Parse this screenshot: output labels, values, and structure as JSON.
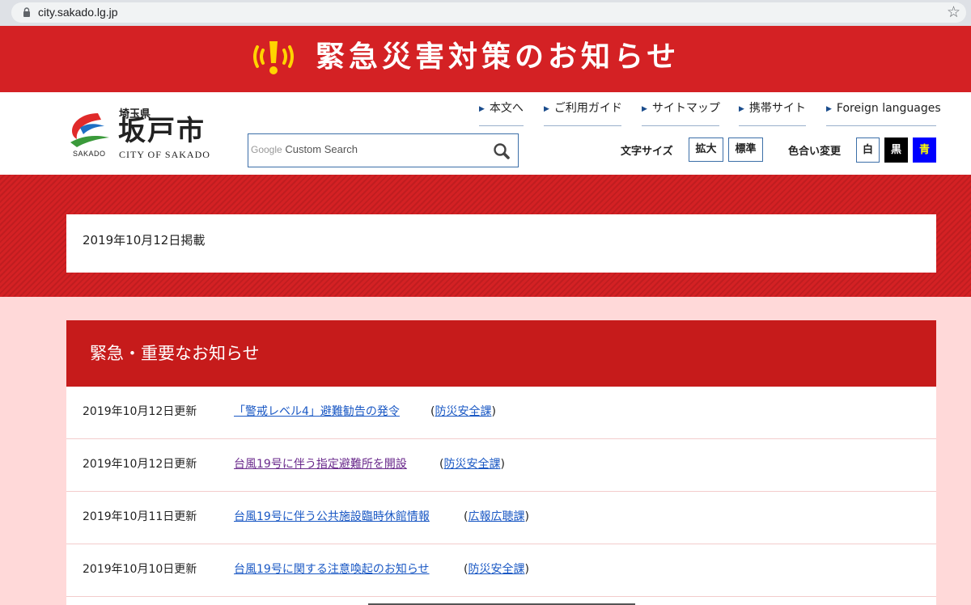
{
  "browser": {
    "url": "city.sakado.lg.jp"
  },
  "banner": {
    "title": "緊急災害対策のお知らせ",
    "color": "#d42124"
  },
  "logo": {
    "prefecture": "埼玉県",
    "city": "坂戸市",
    "english": "CITY OF SAKADO",
    "mark_text": "SAKADO"
  },
  "search": {
    "brand": "Google",
    "placeholder": "Custom Search"
  },
  "nav": [
    {
      "label": "本文へ"
    },
    {
      "label": "ご利用ガイド"
    },
    {
      "label": "サイトマップ"
    },
    {
      "label": "携帯サイト"
    },
    {
      "label": "Foreign languages"
    }
  ],
  "font_size": {
    "label": "文字サイズ",
    "enlarge": "拡大",
    "standard": "標準"
  },
  "color_change": {
    "label": "色合い変更",
    "white": "白",
    "black": "黒",
    "blue": "青"
  },
  "posted": {
    "date": "2019年10月12日掲載"
  },
  "news": {
    "heading": "緊急・重要なお知らせ",
    "items": [
      {
        "date": "2019年10月12日更新",
        "title": "「警戒レベル4」避難勧告の発令",
        "dept": "防災安全課",
        "visited": false
      },
      {
        "date": "2019年10月12日更新",
        "title": "台風19号に伴う指定避難所を開設",
        "dept": "防災安全課",
        "visited": true
      },
      {
        "date": "2019年10月11日更新",
        "title": "台風19号に伴う公共施設臨時休館情報",
        "dept": "広報広聴課",
        "visited": false
      },
      {
        "date": "2019年10月10日更新",
        "title": "台風19号に関する注意喚起のお知らせ",
        "dept": "防災安全課",
        "visited": false
      }
    ]
  },
  "colors": {
    "accent_red": "#c61b1b",
    "link_blue": "#1a58c4",
    "link_visited": "#6a2a8c",
    "background_pink": "#ffd9d9"
  }
}
